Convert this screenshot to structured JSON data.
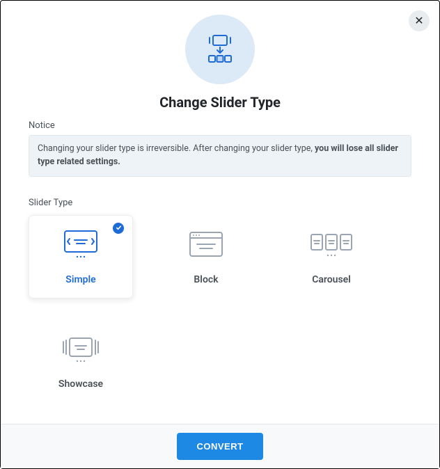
{
  "title": "Change Slider Type",
  "notice": {
    "label": "Notice",
    "text_part1": "Changing your slider type is irreversible. After changing your slider type, ",
    "text_bold": "you will lose all slider type related settings."
  },
  "slider_type_label": "Slider Type",
  "options": [
    {
      "label": "Simple",
      "selected": true
    },
    {
      "label": "Block",
      "selected": false
    },
    {
      "label": "Carousel",
      "selected": false
    },
    {
      "label": "Showcase",
      "selected": false
    }
  ],
  "convert_button": "CONVERT",
  "close_symbol": "✕"
}
